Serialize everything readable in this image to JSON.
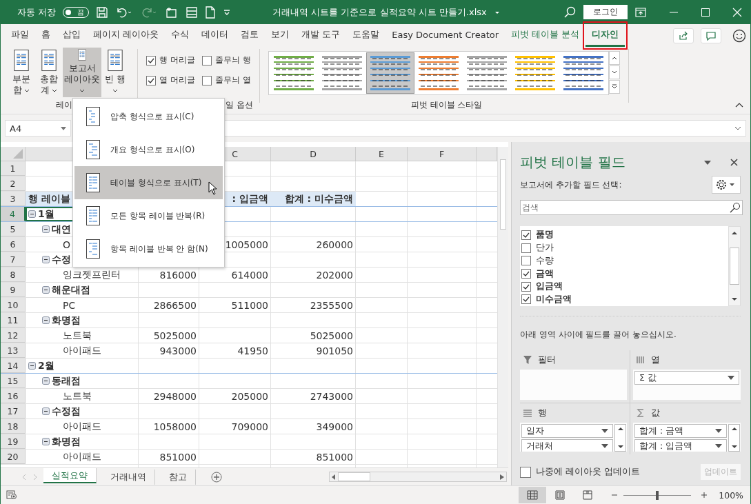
{
  "title_bar": {
    "autosave_label": "자동 저장",
    "autosave": {
      "on": false,
      "label": "끔"
    },
    "title": "거래내역 시트를 기준으로 실적요약 시트 만들기.xlsx",
    "login": "로그인"
  },
  "ribbon_tabs": [
    {
      "label": "파일",
      "kind": "normal",
      "selected": false,
      "highlighted": false
    },
    {
      "label": "홈",
      "kind": "normal",
      "selected": false,
      "highlighted": false
    },
    {
      "label": "삽입",
      "kind": "normal",
      "selected": false,
      "highlighted": false
    },
    {
      "label": "페이지 레이아웃",
      "kind": "normal",
      "selected": false,
      "highlighted": false
    },
    {
      "label": "수식",
      "kind": "normal",
      "selected": false,
      "highlighted": false
    },
    {
      "label": "데이터",
      "kind": "normal",
      "selected": false,
      "highlighted": false
    },
    {
      "label": "검토",
      "kind": "normal",
      "selected": false,
      "highlighted": false
    },
    {
      "label": "보기",
      "kind": "normal",
      "selected": false,
      "highlighted": false
    },
    {
      "label": "개발 도구",
      "kind": "normal",
      "selected": false,
      "highlighted": false
    },
    {
      "label": "도움말",
      "kind": "normal",
      "selected": false,
      "highlighted": false
    },
    {
      "label": "Easy Document Creator",
      "kind": "normal",
      "selected": false,
      "highlighted": false
    },
    {
      "label": "피벗 테이블 분석",
      "kind": "contextual",
      "selected": false,
      "highlighted": false
    },
    {
      "label": "디자인",
      "kind": "contextual",
      "selected": true,
      "highlighted": true
    }
  ],
  "ribbon": {
    "layout_buttons": [
      {
        "label": "부분합",
        "pressed": false
      },
      {
        "label": "총합계",
        "pressed": false
      },
      {
        "label": "보고서 레이아웃",
        "pressed": true
      },
      {
        "label": "빈 행",
        "pressed": false
      }
    ],
    "options": [
      {
        "label": "행 머리글",
        "checked": true
      },
      {
        "label": "줄무늬 행",
        "checked": false
      },
      {
        "label": "열 머리글",
        "checked": true
      },
      {
        "label": "줄무늬 열",
        "checked": false
      }
    ],
    "styles": [
      {
        "color": "#70ad47",
        "selected": false
      },
      {
        "color": "#a5a5a5",
        "selected": false
      },
      {
        "color": "#5b9bd5",
        "selected": true
      },
      {
        "color": "#ed7d31",
        "selected": false
      },
      {
        "color": "#a5a5a5",
        "selected": false
      },
      {
        "color": "#ffc000",
        "selected": false
      },
      {
        "color": "#4472c4",
        "selected": false
      }
    ],
    "group_labels": [
      "레이",
      "일 옵션",
      "피벗 테이블 스타일"
    ]
  },
  "name_box": "A4",
  "layout_menu": {
    "items": [
      {
        "label": "압축 형식으로 표시(C)",
        "selected": false
      },
      {
        "label": "개요 형식으로 표시(O)",
        "selected": false
      },
      {
        "label": "테이블 형식으로 표시(T)",
        "selected": true
      },
      {
        "label": "모든 항목 레이블 반복(R)",
        "selected": false
      },
      {
        "label": "항목 레이블 반복 안 함(N)",
        "selected": false
      }
    ]
  },
  "sheet": {
    "columns": [
      "C",
      "D",
      "E",
      "F"
    ],
    "rows": [
      {
        "num": "1",
        "kind": "blank",
        "selected": false
      },
      {
        "num": "2",
        "kind": "blank",
        "selected": false
      },
      {
        "num": "3",
        "kind": "header",
        "selected": false,
        "a": "행 레이블",
        "c": ": 입금액",
        "d": "합계 : 미수금액"
      },
      {
        "num": "4",
        "kind": "month",
        "selected": true,
        "expanded": true,
        "a": "1월"
      },
      {
        "num": "5",
        "kind": "store",
        "selected": false,
        "expanded": true,
        "a": "대연"
      },
      {
        "num": "6",
        "kind": "item",
        "selected": false,
        "a": "O",
        "c": "1005000",
        "d": "260000"
      },
      {
        "num": "7",
        "kind": "store",
        "selected": false,
        "expanded": true,
        "a": "수정"
      },
      {
        "num": "8",
        "kind": "item",
        "selected": false,
        "a": "잉크젯프린터",
        "b": "816000",
        "c": "614000",
        "d": "202000"
      },
      {
        "num": "9",
        "kind": "store",
        "selected": false,
        "expanded": true,
        "a": "해운대점"
      },
      {
        "num": "10",
        "kind": "item",
        "selected": false,
        "a": "PC",
        "b": "2866500",
        "c": "511000",
        "d": "2355500"
      },
      {
        "num": "11",
        "kind": "store",
        "selected": false,
        "expanded": true,
        "a": "화명점"
      },
      {
        "num": "12",
        "kind": "item",
        "selected": false,
        "a": "노트북",
        "b": "5025000",
        "d": "5025000"
      },
      {
        "num": "13",
        "kind": "item",
        "selected": false,
        "a": "아이패드",
        "b": "943000",
        "c": "41950",
        "d": "901050"
      },
      {
        "num": "14",
        "kind": "month",
        "selected": false,
        "expanded": true,
        "a": "2월"
      },
      {
        "num": "15",
        "kind": "store",
        "selected": false,
        "expanded": true,
        "a": "동래점"
      },
      {
        "num": "16",
        "kind": "item",
        "selected": false,
        "a": "노트북",
        "b": "2948000",
        "c": "205000",
        "d": "2743000"
      },
      {
        "num": "17",
        "kind": "store",
        "selected": false,
        "expanded": true,
        "a": "수정점"
      },
      {
        "num": "18",
        "kind": "item",
        "selected": false,
        "a": "아이패드",
        "b": "1058000",
        "c": "709000",
        "d": "349000"
      },
      {
        "num": "19",
        "kind": "store",
        "selected": false,
        "expanded": true,
        "a": "화명점"
      },
      {
        "num": "20",
        "kind": "item",
        "selected": false,
        "a": "아이패드",
        "b": "851000",
        "d": "851000"
      }
    ]
  },
  "sheet_tabs": [
    {
      "label": "실적요약",
      "selected": true
    },
    {
      "label": "거래내역",
      "selected": false
    },
    {
      "label": "참고",
      "selected": false
    }
  ],
  "pane": {
    "title": "피벗 테이블 필드",
    "subtitle": "보고서에 추가할 필드 선택:",
    "search_placeholder": "검색",
    "fields": [
      {
        "label": "품명",
        "checked": true
      },
      {
        "label": "단가",
        "checked": false
      },
      {
        "label": "수량",
        "checked": false
      },
      {
        "label": "금액",
        "checked": true
      },
      {
        "label": "입금액",
        "checked": true
      },
      {
        "label": "미수금액",
        "checked": true
      }
    ],
    "hint": "아래 영역 사이에 필드를 끌어 놓으십시오.",
    "areas": [
      {
        "kind": "filter",
        "label": "필터"
      },
      {
        "kind": "columns",
        "label": "열",
        "items": [
          "Σ 값"
        ]
      },
      {
        "kind": "rows",
        "label": "행",
        "items": [
          "일자",
          "거래처"
        ]
      },
      {
        "kind": "values",
        "label": "값",
        "items": [
          "합계 : 금액",
          "합계 : 입금액"
        ]
      }
    ],
    "defer": {
      "label": "나중에 레이아웃 업데이트",
      "checked": false
    },
    "update_button": {
      "label": "업데이트",
      "disabled": true
    }
  },
  "status_bar": {
    "views": [
      {
        "kind": "normal",
        "selected": true
      },
      {
        "kind": "page_layout",
        "selected": false
      },
      {
        "kind": "page_break",
        "selected": false
      }
    ],
    "zoom": {
      "level": 0.5,
      "label": "100%"
    }
  }
}
